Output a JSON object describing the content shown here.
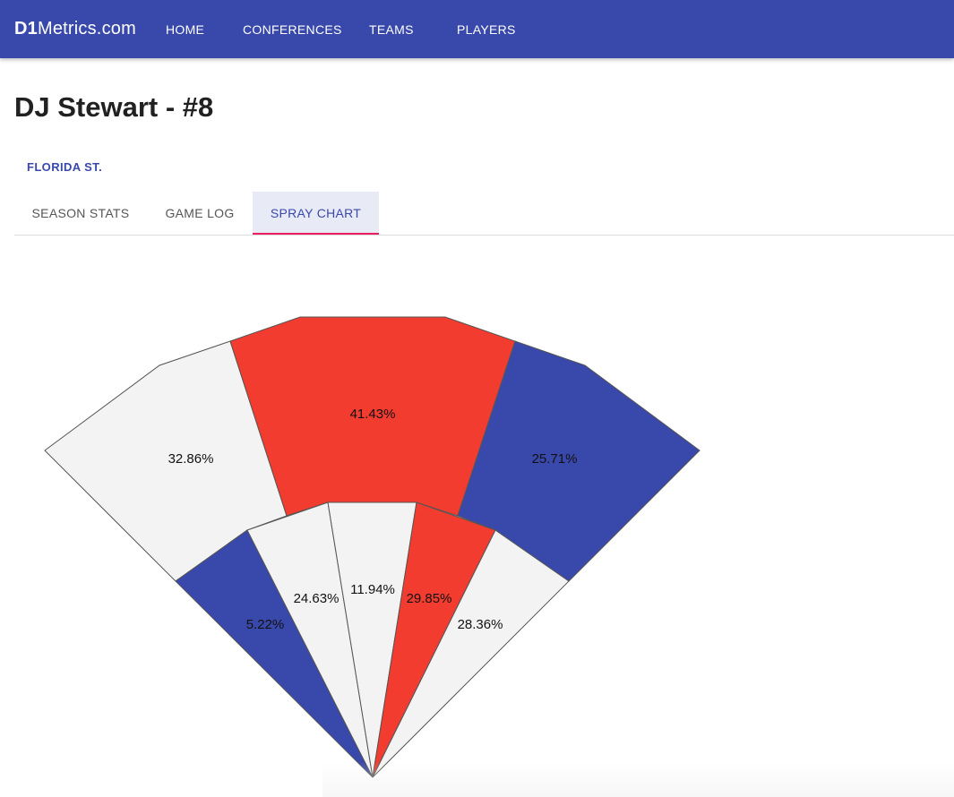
{
  "header": {
    "brand_bold": "D1",
    "brand_rest": "Metrics.com",
    "nav": [
      "HOME",
      "CONFERENCES",
      "TEAMS",
      "PLAYERS"
    ]
  },
  "player": {
    "title": "DJ Stewart - #8",
    "team": "FLORIDA ST."
  },
  "tabs": {
    "items": [
      "SEASON STATS",
      "GAME LOG",
      "SPRAY CHART"
    ],
    "active": "SPRAY CHART"
  },
  "colors": {
    "appbar": "#3949ab",
    "red": "#f23c2f",
    "blue": "#3949ab",
    "light": "#f3f3f3",
    "tab_indicator": "#e91e63"
  },
  "chart_data": {
    "type": "spray",
    "title": "",
    "outfield": {
      "zones": [
        "left",
        "center",
        "right"
      ],
      "values": [
        32.86,
        41.43,
        25.71
      ],
      "labels": [
        "32.86%",
        "41.43%",
        "25.71%"
      ],
      "colors": [
        "light",
        "red",
        "blue"
      ]
    },
    "infield": {
      "zones": [
        "left-line",
        "left-side",
        "middle",
        "right-side",
        "right-line"
      ],
      "values": [
        5.22,
        24.63,
        11.94,
        29.85,
        28.36
      ],
      "labels": [
        "5.22%",
        "24.63%",
        "11.94%",
        "29.85%",
        "28.36%"
      ],
      "colors": [
        "blue",
        "light",
        "light",
        "red",
        "light"
      ]
    }
  }
}
